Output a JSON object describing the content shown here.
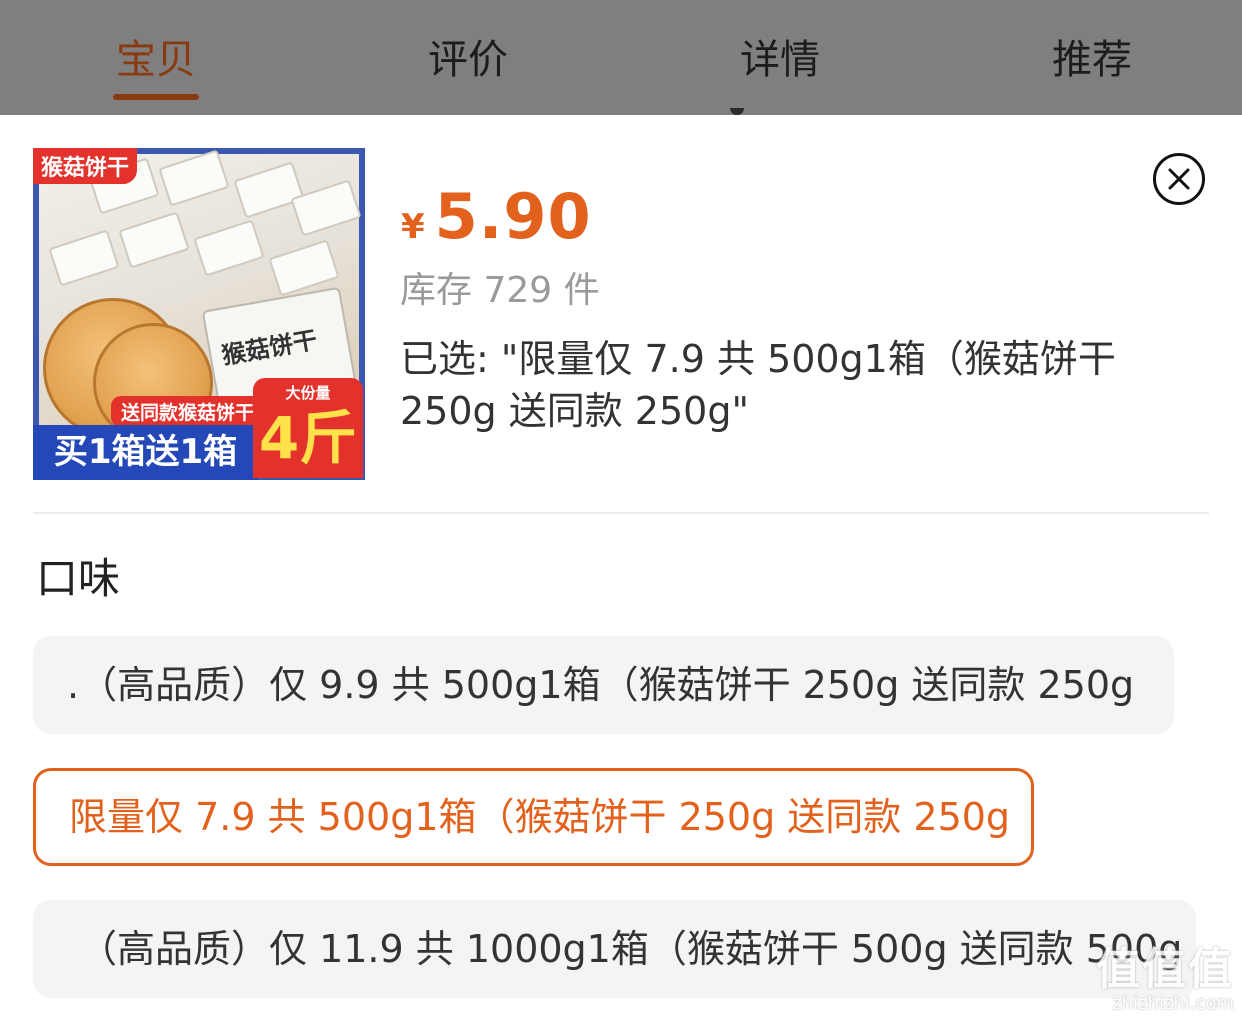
{
  "tabs": [
    {
      "label": "宝贝",
      "active": true
    },
    {
      "label": "评价",
      "active": false
    },
    {
      "label": "详情",
      "active": false
    },
    {
      "label": "推荐",
      "active": false
    }
  ],
  "product": {
    "thumbnail": {
      "tag": "猴菇饼干",
      "ribbon": "送同款猴菇饼干",
      "banner": "买1箱送1箱",
      "badge_small": "大份量",
      "badge_big": "4斤",
      "pack_text": "猴菇饼干"
    },
    "currency": "¥",
    "price": "5.90",
    "stock": "库存 729 件",
    "selected": "已选: \"限量仅 7.9 共 500g1箱（猴菇饼干 250g 送同款 250g\""
  },
  "spec": {
    "title": "口味",
    "options": [
      {
        "label": ".（高品质）仅 9.9 共 500g1箱（猴菇饼干 250g 送同款 250g",
        "selected": false
      },
      {
        "label": "限量仅 7.9 共 500g1箱（猴菇饼干 250g 送同款 250g",
        "selected": true
      },
      {
        "label": "（高品质）仅 11.9 共 1000g1箱（猴菇饼干 500g 送同款 500g",
        "selected": false
      }
    ]
  },
  "icons": {
    "close": "close-circle-icon"
  },
  "colors": {
    "accent": "#e2611c",
    "tabbar_overlay": "#7f7f7f",
    "active_tab": "#8a3a10"
  },
  "watermark": {
    "logo": "值值值",
    "url": "zhizhizhi.com"
  }
}
